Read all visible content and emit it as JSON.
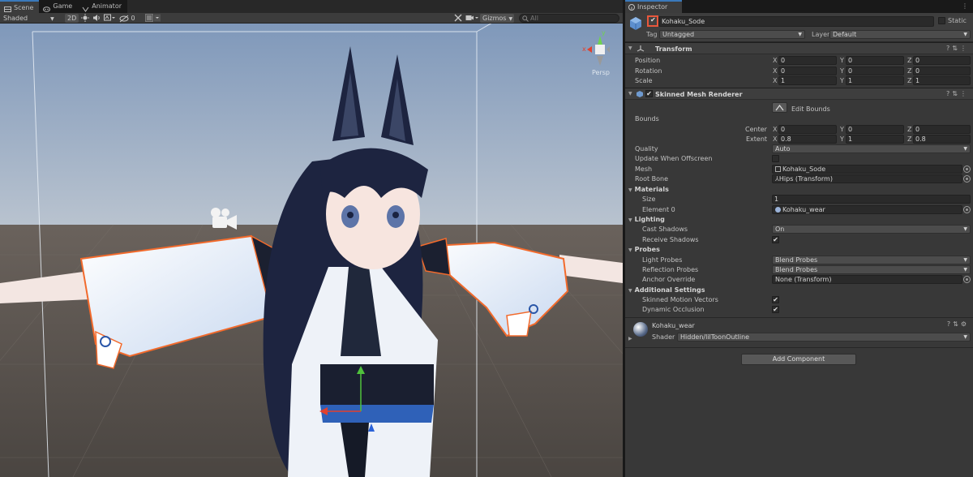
{
  "scene": {
    "tabs": [
      {
        "label": "Scene",
        "icon": "scene-icon"
      },
      {
        "label": "Game",
        "icon": "game-icon"
      },
      {
        "label": "Animator",
        "icon": "animator-icon"
      }
    ],
    "toolbar": {
      "shading_mode": "Shaded",
      "mode_2d": "2D",
      "hidden_count": "0",
      "gizmos_label": "Gizmos",
      "search_placeholder": "All"
    },
    "gizmo": {
      "x_label": "x",
      "y_label": "y",
      "view_label": "Persp"
    }
  },
  "inspector": {
    "tab_label": "Inspector",
    "object": {
      "name": "Kohaku_Sode",
      "active": true,
      "static_label": "Static",
      "tag_label": "Tag",
      "tag_value": "Untagged",
      "layer_label": "Layer",
      "layer_value": "Default"
    },
    "transform": {
      "title": "Transform",
      "rows": [
        {
          "label": "Position",
          "x": "0",
          "y": "0",
          "z": "0"
        },
        {
          "label": "Rotation",
          "x": "0",
          "y": "0",
          "z": "0"
        },
        {
          "label": "Scale",
          "x": "1",
          "y": "1",
          "z": "1"
        }
      ]
    },
    "renderer": {
      "title": "Skinned Mesh Renderer",
      "edit_bounds_label": "Edit Bounds",
      "bounds_label": "Bounds",
      "center_label": "Center",
      "center": {
        "x": "0",
        "y": "0",
        "z": "0"
      },
      "extent_label": "Extent",
      "extent": {
        "x": "0.8",
        "y": "1",
        "z": "0.8"
      },
      "quality_label": "Quality",
      "quality_value": "Auto",
      "update_offscreen_label": "Update When Offscreen",
      "mesh_label": "Mesh",
      "mesh_value": "Kohaku_Sode",
      "root_bone_label": "Root Bone",
      "root_bone_value": "Hips (Transform)",
      "materials_label": "Materials",
      "size_label": "Size",
      "size_value": "1",
      "element0_label": "Element 0",
      "element0_value": "Kohaku_wear",
      "lighting_label": "Lighting",
      "cast_shadows_label": "Cast Shadows",
      "cast_shadows_value": "On",
      "receive_shadows_label": "Receive Shadows",
      "probes_label": "Probes",
      "light_probes_label": "Light Probes",
      "light_probes_value": "Blend Probes",
      "reflection_probes_label": "Reflection Probes",
      "reflection_probes_value": "Blend Probes",
      "anchor_override_label": "Anchor Override",
      "anchor_override_value": "None (Transform)",
      "additional_settings_label": "Additional Settings",
      "skinned_motion_label": "Skinned Motion Vectors",
      "dynamic_occlusion_label": "Dynamic Occlusion"
    },
    "material": {
      "name": "Kohaku_wear",
      "shader_label": "Shader",
      "shader_value": "Hidden/lilToonOutline"
    },
    "add_component_label": "Add Component"
  },
  "colors": {
    "sky_top": "#7f98ba",
    "sky_bottom": "#b7c2ce",
    "ground": "#57514c",
    "hair": "#1d2440",
    "selection_outline": "#f26a2c",
    "accent_blue": "#3a79bb",
    "active_check_highlight": "#e8573c"
  }
}
